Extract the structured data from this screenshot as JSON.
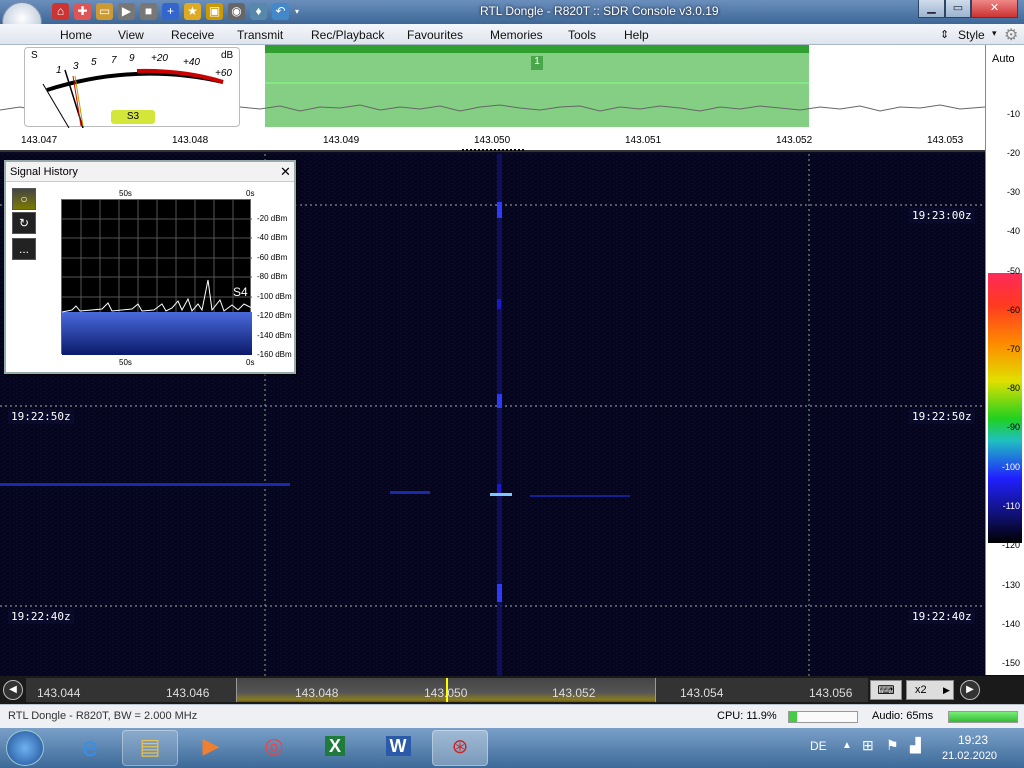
{
  "window": {
    "title": "RTL Dongle - R820T :: SDR Console v3.0.19"
  },
  "menu": {
    "items": [
      "Home",
      "View",
      "Receive",
      "Transmit",
      "Rec/Playback",
      "Favourites",
      "Memories",
      "Tools",
      "Help"
    ],
    "style_label": "Style"
  },
  "smeter": {
    "s_label": "S",
    "db_label": "dB",
    "s_ticks": [
      "1",
      "3",
      "5",
      "7",
      "9",
      "+20",
      "+40",
      "+60"
    ],
    "reading": "S3"
  },
  "spectrum": {
    "passband_label": "1",
    "freq_ticks": [
      "143.047",
      "143.048",
      "143.049",
      "143.050",
      "143.051",
      "143.052",
      "143.053"
    ]
  },
  "waterfall": {
    "time_labels": [
      "19:23:00z",
      "19:22:50z",
      "19:22:40z"
    ]
  },
  "right_scale": {
    "auto_label": "Auto",
    "db_ticks": [
      "-10",
      "-20",
      "-30",
      "-40",
      "-50",
      "-60",
      "-70",
      "-80",
      "-90",
      "-100",
      "-110",
      "-120",
      "-130",
      "-140",
      "-150"
    ]
  },
  "signal_history": {
    "title": "Signal History",
    "time_left": "50s",
    "time_right": "0s",
    "dbm_ticks": [
      "-20 dBm",
      "-40 dBm",
      "-60 dBm",
      "-80 dBm",
      "-100 dBm",
      "-120 dBm",
      "-140 dBm",
      "-160 dBm"
    ],
    "s_reading": "S4",
    "refresh_label": "↻",
    "more_label": "..."
  },
  "bottom": {
    "freqs": [
      "143.044",
      "143.046",
      "143.048",
      "143.050",
      "143.052",
      "143.054",
      "143.056"
    ],
    "zoom_label": "x2"
  },
  "status": {
    "device": "RTL Dongle - R820T, BW = 2.000 MHz",
    "cpu": "CPU: 11.9%",
    "audio": "Audio: 65ms",
    "cpu_level": 0.119
  },
  "taskbar": {
    "lang": "DE",
    "time": "19:23",
    "date": "21.02.2020"
  },
  "colors": {
    "accent": "#30c030",
    "waterfall_bg": "#04041a"
  }
}
